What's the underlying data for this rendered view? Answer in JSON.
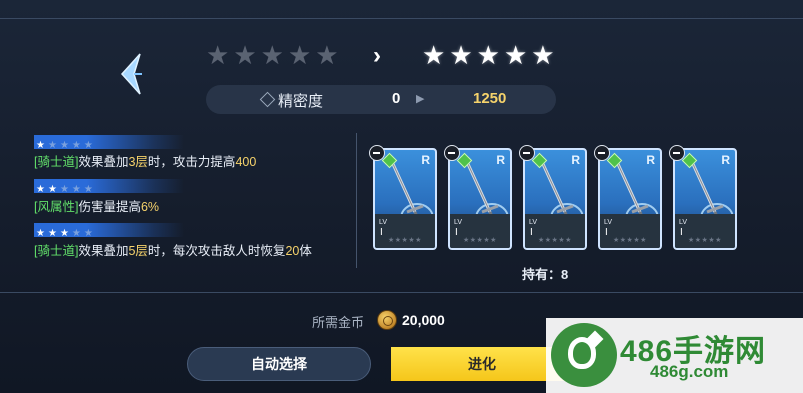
{
  "header": {
    "back_icon": "chevron-left-icon",
    "current_stars": 0,
    "max_stars": 5,
    "next_stars": 5,
    "arrow": "›"
  },
  "precision": {
    "label": "精密度",
    "current": "0",
    "next": "1250"
  },
  "effects": [
    {
      "stars": 1,
      "parts": [
        {
          "text": "[骑士道]",
          "c": "g"
        },
        {
          "text": "效果叠加",
          "c": ""
        },
        {
          "text": "3层",
          "c": "y"
        },
        {
          "text": "时，攻击力提高",
          "c": ""
        },
        {
          "text": "400",
          "c": "y"
        }
      ]
    },
    {
      "stars": 2,
      "parts": [
        {
          "text": "[风属性]",
          "c": "g"
        },
        {
          "text": "伤害量提高",
          "c": ""
        },
        {
          "text": "6%",
          "c": "y"
        }
      ]
    },
    {
      "stars": 3,
      "parts": [
        {
          "text": "[骑士道]",
          "c": "g"
        },
        {
          "text": "效果叠加",
          "c": ""
        },
        {
          "text": "5层",
          "c": "y"
        },
        {
          "text": "时，每次攻击敌人时恢复",
          "c": ""
        },
        {
          "text": "20",
          "c": "y"
        },
        {
          "text": "体",
          "c": ""
        }
      ]
    }
  ],
  "materials": {
    "cards": [
      {
        "rank": "R",
        "lv_label": "LV",
        "lv": "I"
      },
      {
        "rank": "R",
        "lv_label": "LV",
        "lv": "I"
      },
      {
        "rank": "R",
        "lv_label": "LV",
        "lv": "I"
      },
      {
        "rank": "R",
        "lv_label": "LV",
        "lv": "I"
      },
      {
        "rank": "R",
        "lv_label": "LV",
        "lv": "I"
      }
    ],
    "owned_text": "持有：8"
  },
  "cost": {
    "label": "所需金币",
    "value": "20,000"
  },
  "buttons": {
    "auto_select": "自动选择",
    "evolve": "进化"
  },
  "watermark": {
    "main": "486手游网",
    "sub": "486g.com"
  },
  "colors": {
    "accent_blue": "#2a6bd9",
    "highlight_yellow": "#f6d36b",
    "tag_green": "#62e06a",
    "button_yellow": "#f5c61a"
  }
}
